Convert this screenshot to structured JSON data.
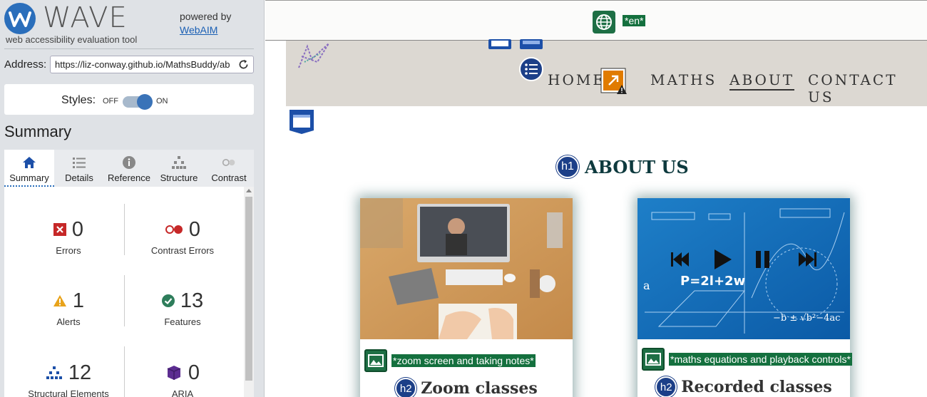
{
  "wave": {
    "title": "WAVE",
    "subtitle": "web accessibility evaluation tool",
    "powered_by": "powered by",
    "webaim": "WebAIM",
    "address_label": "Address:",
    "address_value": "https://liz-conway.github.io/MathsBuddy/ab",
    "styles_label": "Styles:",
    "toggle_off": "OFF",
    "toggle_on": "ON",
    "summary_heading": "Summary",
    "tabs": [
      {
        "label": "Summary",
        "icon": "home-icon"
      },
      {
        "label": "Details",
        "icon": "list-icon"
      },
      {
        "label": "Reference",
        "icon": "info-icon"
      },
      {
        "label": "Structure",
        "icon": "hierarchy-icon"
      },
      {
        "label": "Contrast",
        "icon": "contrast-icon"
      }
    ],
    "stats": {
      "errors": {
        "value": "0",
        "label": "Errors"
      },
      "contrast": {
        "value": "0",
        "label": "Contrast Errors"
      },
      "alerts": {
        "value": "1",
        "label": "Alerts"
      },
      "features": {
        "value": "13",
        "label": "Features"
      },
      "structural": {
        "value": "12",
        "label": "Structural Elements"
      },
      "aria": {
        "value": "0",
        "label": "ARIA"
      }
    },
    "colors": {
      "error": "#c62828",
      "alert": "#e8a31b",
      "feature": "#2e7d5b",
      "structure": "#1c4fa8",
      "aria": "#5c2d91"
    }
  },
  "page": {
    "lang_tag": "*en*",
    "nav": {
      "home": "HOME",
      "maths": "MATHS",
      "about": "ABOUT",
      "contact": "CONTACT US"
    },
    "h1_badge": "h1",
    "h1": "ABOUT US",
    "cards": [
      {
        "alt": "*zoom screen and taking notes*",
        "h2_badge": "h2",
        "title": "Zoom classes"
      },
      {
        "alt": "*maths equations and playback controls*",
        "h2_badge": "h2",
        "title": "Recorded classes"
      }
    ]
  }
}
